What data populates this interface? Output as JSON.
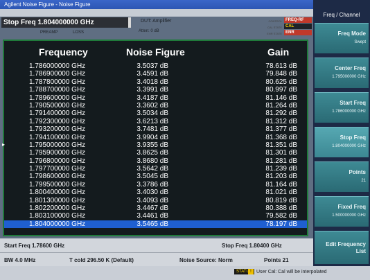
{
  "window": {
    "title": "Agilent Noise Figure - Noise Figure"
  },
  "header": {
    "freq_display": "Stop Freq 1.804000000 GHz",
    "dut_label": "DUT: Amplifier",
    "atten_label": "Atten: 0 dB",
    "preamp_label": "PREAMP",
    "loss_label": "LOSS",
    "status_labels": [
      "CONTROL",
      "CAL STATE",
      "ENR STATE"
    ],
    "badges": [
      "FREQ-RF",
      "CAL",
      "ENR"
    ]
  },
  "table": {
    "headers": {
      "frequency": "Frequency",
      "noise_figure": "Noise Figure",
      "gain": "Gain"
    },
    "rows": [
      {
        "freq": "1.786000000 GHz",
        "nf": "3.5037 dB",
        "gain": "78.613 dB"
      },
      {
        "freq": "1.786900000 GHz",
        "nf": "3.4591 dB",
        "gain": "79.848 dB"
      },
      {
        "freq": "1.787800000 GHz",
        "nf": "3.4018 dB",
        "gain": "80.625 dB"
      },
      {
        "freq": "1.788700000 GHz",
        "nf": "3.3991 dB",
        "gain": "80.997 dB"
      },
      {
        "freq": "1.789600000 GHz",
        "nf": "3.4187 dB",
        "gain": "81.146 dB"
      },
      {
        "freq": "1.790500000 GHz",
        "nf": "3.3602 dB",
        "gain": "81.264 dB"
      },
      {
        "freq": "1.791400000 GHz",
        "nf": "3.5034 dB",
        "gain": "81.292 dB"
      },
      {
        "freq": "1.792300000 GHz",
        "nf": "3.6213 dB",
        "gain": "81.312 dB"
      },
      {
        "freq": "1.793200000 GHz",
        "nf": "3.7481 dB",
        "gain": "81.377 dB"
      },
      {
        "freq": "1.794100000 GHz",
        "nf": "3.9904 dB",
        "gain": "81.368 dB"
      },
      {
        "freq": "1.795000000 GHz",
        "nf": "3.9355 dB",
        "gain": "81.351 dB"
      },
      {
        "freq": "1.795900000 GHz",
        "nf": "3.8625 dB",
        "gain": "81.301 dB"
      },
      {
        "freq": "1.796800000 GHz",
        "nf": "3.8680 dB",
        "gain": "81.281 dB"
      },
      {
        "freq": "1.797700000 GHz",
        "nf": "3.5642 dB",
        "gain": "81.239 dB"
      },
      {
        "freq": "1.798600000 GHz",
        "nf": "3.5045 dB",
        "gain": "81.203 dB"
      },
      {
        "freq": "1.799500000 GHz",
        "nf": "3.3786 dB",
        "gain": "81.164 dB"
      },
      {
        "freq": "1.800400000 GHz",
        "nf": "3.4030 dB",
        "gain": "81.021 dB"
      },
      {
        "freq": "1.801300000 GHz",
        "nf": "3.4093 dB",
        "gain": "80.819 dB"
      },
      {
        "freq": "1.802200000 GHz",
        "nf": "3.4467 dB",
        "gain": "80.388 dB"
      },
      {
        "freq": "1.803100000 GHz",
        "nf": "3.4461 dB",
        "gain": "79.582 dB"
      },
      {
        "freq": "1.804000000 GHz",
        "nf": "3.5465 dB",
        "gain": "78.197 dB"
      }
    ],
    "selected_index": 20
  },
  "footer": {
    "start_freq": "Start Freq 1.78600 GHz",
    "stop_freq": "Stop Freq 1.80400 GHz",
    "bw": "BW 4.0 MHz",
    "tcold": "T cold 296.50 K (Default)",
    "noise_source": "Noise Source: Norm",
    "points": "Points 21"
  },
  "statusbar": {
    "label": "STATUS",
    "warn_icon": "!",
    "message": "User Cal: Cal will be interpolated"
  },
  "softkeys": {
    "title": "Freq / Channel",
    "keys": [
      {
        "l1": "Freq Mode",
        "l2": "Swept"
      },
      {
        "l1": "Center Freq",
        "l2": "1.795000000 GHz"
      },
      {
        "l1": "Start Freq",
        "l2": "1.786000000 GHz"
      },
      {
        "l1": "Stop Freq",
        "l2": "1.804000000 GHz"
      },
      {
        "l1": "Points",
        "l2": "21"
      },
      {
        "l1": "Fixed Freq",
        "l2": "1.500000000 GHz"
      },
      {
        "l1": "Edit Frequency List",
        "l2": ""
      }
    ]
  },
  "colors": {
    "selected_row": "#1f5fd0",
    "badge_red": "#c0392b",
    "softkey": "#3e8a94"
  }
}
